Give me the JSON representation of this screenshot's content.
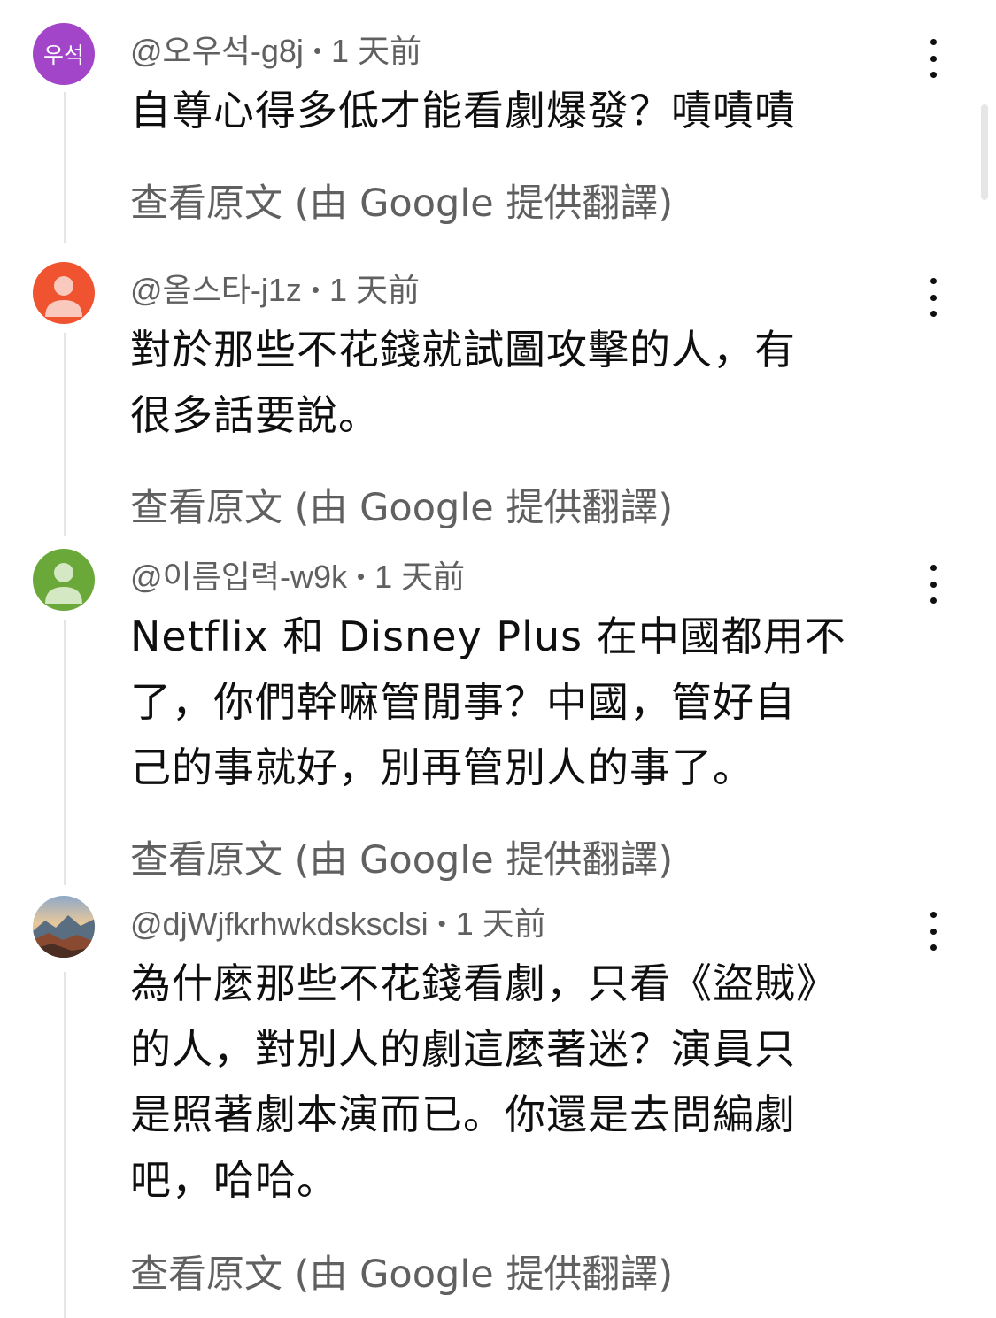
{
  "comments": [
    {
      "avatar_text": "우석",
      "avatar_color": "#a245c8",
      "username": "@오우석-g8j",
      "timestamp": "1 天前",
      "text": "自尊心得多低才能看劇爆發？嘖嘖嘖",
      "translate_label": "查看原文 (由 Google 提供翻譯)"
    },
    {
      "avatar_color": "#f0532f",
      "username": "@올스타-j1z",
      "timestamp": "1 天前",
      "text": "對於那些不花錢就試圖攻擊的人，有\n很多話要說。",
      "translate_label": "查看原文 (由 Google 提供翻譯)"
    },
    {
      "avatar_color": "#6aa83a",
      "username": "@이름입력-w9k",
      "timestamp": "1 天前",
      "text": "Netflix 和 Disney Plus 在中國都用不\n了，你們幹嘛管閒事？中國，管好自\n己的事就好，別再管別人的事了。",
      "translate_label": "查看原文 (由 Google 提供翻譯)"
    },
    {
      "avatar_color": "#7a6a5a",
      "username": "@djWjfkrhwkdsksclsi",
      "timestamp": "1 天前",
      "text": "為什麼那些不花錢看劇，只看《盜賊》\n的人，對別人的劇這麼著迷？演員只\n是照著劇本演而已。你還是去問編劇\n吧，哈哈。",
      "translate_label": "查看原文 (由 Google 提供翻譯)"
    }
  ],
  "icons": {
    "more": "more-vertical-icon",
    "default_avatar": "person-icon"
  }
}
